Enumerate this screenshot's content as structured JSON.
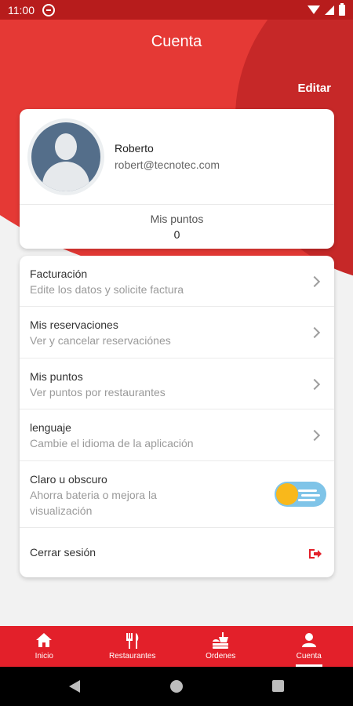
{
  "status_bar": {
    "time": "11:00"
  },
  "header": {
    "title": "Cuenta",
    "edit_label": "Editar"
  },
  "profile": {
    "name": "Roberto",
    "email": "robert@tecnotec.com",
    "points_label": "Mis puntos",
    "points_value": "0"
  },
  "menu": {
    "items": [
      {
        "label": "Facturación",
        "sub": "Edite los datos y solicite factura"
      },
      {
        "label": "Mis reservaciones",
        "sub": "Ver y cancelar reservaciónes"
      },
      {
        "label": "Mis puntos",
        "sub": "Ver puntos por restaurantes"
      },
      {
        "label": "lenguaje",
        "sub": "Cambie el idioma de la aplicación"
      },
      {
        "label": "Claro u obscuro",
        "sub_line1": "Ahorra bateria o mejora la",
        "sub_line2": "visualización"
      },
      {
        "label": "Cerrar sesión"
      }
    ]
  },
  "bottom_nav": {
    "items": [
      {
        "label": "Inicio",
        "icon": "home-icon"
      },
      {
        "label": "Restaurantes",
        "icon": "fork-knife-icon"
      },
      {
        "label": "Ordenes",
        "icon": "food-order-icon"
      },
      {
        "label": "Cuenta",
        "icon": "person-icon",
        "active": true
      }
    ]
  },
  "colors": {
    "primary": "#e3202a",
    "header": "#e53935",
    "toggle_track": "#7fc4e8",
    "toggle_knob": "#f9b81b"
  }
}
